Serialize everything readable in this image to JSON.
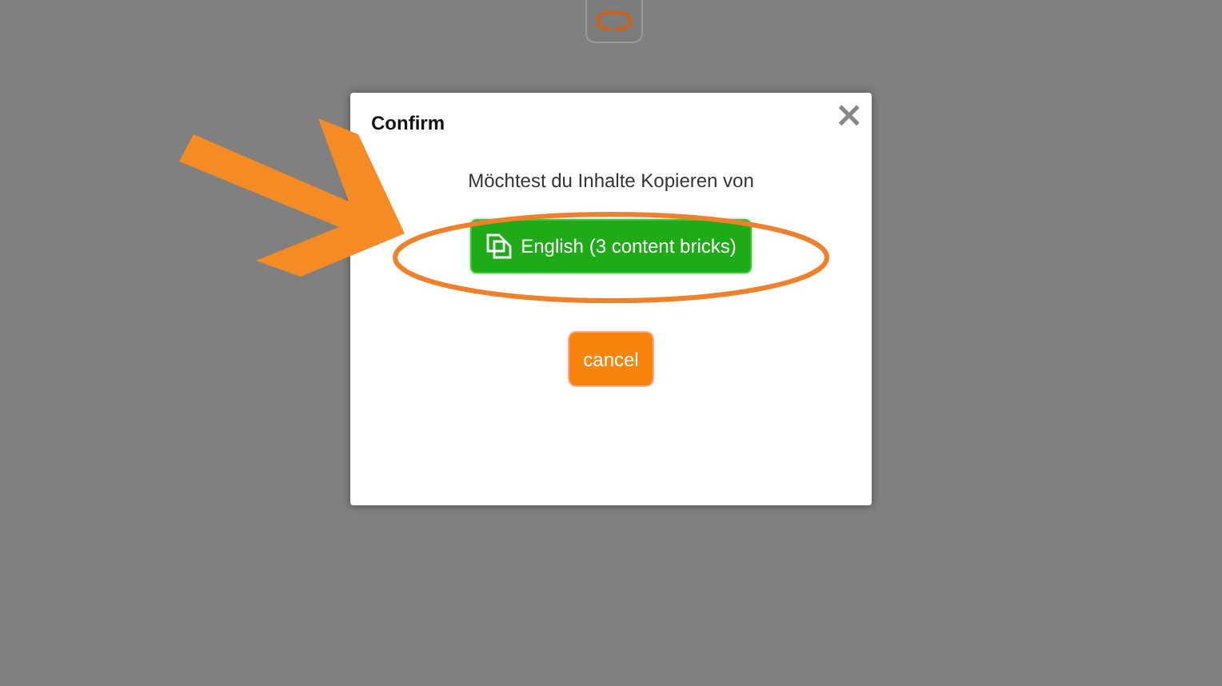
{
  "dialog": {
    "title": "Confirm",
    "close": "×",
    "message": "Möchtest du Inhalte Kopieren von",
    "options": [
      {
        "label": "English (3 content bricks)"
      }
    ],
    "cancel": "cancel"
  }
}
